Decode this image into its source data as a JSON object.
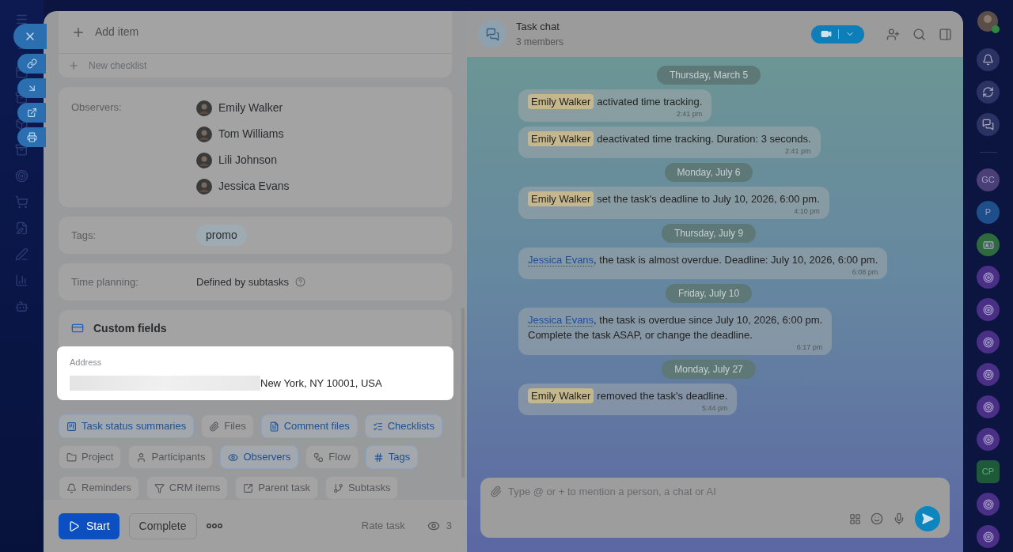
{
  "checklist": {
    "add_item": "Add item",
    "new_checklist": "New checklist"
  },
  "observers": {
    "label": "Observers:",
    "people": [
      "Emily Walker",
      "Tom Williams",
      "Lili Johnson",
      "Jessica Evans"
    ]
  },
  "tags": {
    "label": "Tags:",
    "items": [
      "promo"
    ]
  },
  "time_planning": {
    "label": "Time planning:",
    "value": "Defined by subtasks"
  },
  "custom_fields": {
    "title": "Custom fields",
    "fields": [
      {
        "label": "Address",
        "value": "New York, NY 10001, USA"
      }
    ]
  },
  "chips": [
    {
      "label": "Task status summaries",
      "kind": "summary",
      "active": true
    },
    {
      "label": "Files",
      "kind": "clip",
      "active": false
    },
    {
      "label": "Comment files",
      "kind": "file",
      "active": true
    },
    {
      "label": "Checklists",
      "kind": "list",
      "active": true
    },
    {
      "label": "Project",
      "kind": "folder",
      "active": false
    },
    {
      "label": "Participants",
      "kind": "user",
      "active": false
    },
    {
      "label": "Observers",
      "kind": "eye",
      "active": true
    },
    {
      "label": "Flow",
      "kind": "flow",
      "active": false
    },
    {
      "label": "Tags",
      "kind": "hash",
      "active": true
    },
    {
      "label": "Reminders",
      "kind": "bell",
      "active": false
    },
    {
      "label": "CRM items",
      "kind": "crm",
      "active": false
    },
    {
      "label": "Parent task",
      "kind": "parent",
      "active": false
    },
    {
      "label": "Subtasks",
      "kind": "sub",
      "active": false
    }
  ],
  "footer": {
    "start": "Start",
    "complete": "Complete",
    "rate": "Rate task",
    "views": "3"
  },
  "chat": {
    "title": "Task chat",
    "subtitle": "3 members",
    "messages": [
      {
        "kind": "date",
        "text": "Thursday, March 5"
      },
      {
        "kind": "event",
        "author": "Emily Walker",
        "text": "activated time tracking.",
        "time": "2:41 pm"
      },
      {
        "kind": "event",
        "author": "Emily Walker",
        "text": "deactivated time tracking. Duration: 3 seconds.",
        "time": "2:41 pm"
      },
      {
        "kind": "date",
        "text": "Monday, July 6"
      },
      {
        "kind": "event",
        "author": "Emily Walker",
        "text": "set the task's deadline to July 10, 2026, 6:00 pm.",
        "time": "4:10 pm"
      },
      {
        "kind": "date",
        "text": "Thursday, July 9"
      },
      {
        "kind": "mention",
        "author": "Jessica Evans",
        "text": ", the task is almost overdue. Deadline: July 10, 2026, 6:00 pm.",
        "time": "6:08 pm"
      },
      {
        "kind": "date",
        "text": "Friday, July 10"
      },
      {
        "kind": "mention",
        "author": "Jessica Evans",
        "text": ", the task is overdue since July 10, 2026, 6:00 pm.\nComplete the task ASAP, or change the deadline.",
        "time": "6:17 pm"
      },
      {
        "kind": "date",
        "text": "Monday, July 27"
      },
      {
        "kind": "event",
        "author": "Emily Walker",
        "text": "removed the task's deadline.",
        "time": "5:44 pm"
      }
    ],
    "placeholder": "Type @ or + to mention a person, a chat or AI"
  },
  "rail": [
    {
      "kind": "initials",
      "text": "GC",
      "color": "#4b3f78"
    },
    {
      "kind": "initials",
      "text": "P",
      "color": "#1f4f8a"
    },
    {
      "kind": "contact",
      "color": "#2f6a3f"
    },
    {
      "kind": "channel",
      "color": "#4a2f86"
    },
    {
      "kind": "channel",
      "color": "#4a2f86"
    },
    {
      "kind": "channel",
      "color": "#4a2f86"
    },
    {
      "kind": "channel",
      "color": "#4a2f86"
    },
    {
      "kind": "channel",
      "color": "#4a2f86"
    },
    {
      "kind": "channel",
      "color": "#4a2f86"
    },
    {
      "kind": "hex",
      "text": "CP",
      "color": "#1e5a3a"
    },
    {
      "kind": "channel",
      "color": "#4a2f86"
    },
    {
      "kind": "channel",
      "color": "#4a2f86"
    }
  ]
}
